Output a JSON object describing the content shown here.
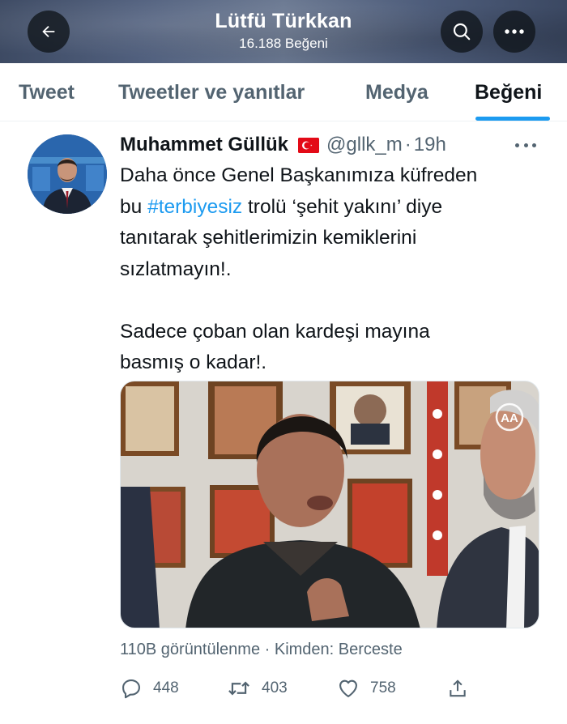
{
  "header": {
    "title": "Lütfü Türkkan",
    "subtitle": "16.188 Beğeni",
    "back_icon": "arrow-left-icon",
    "search_icon": "search-icon",
    "more_icon": "more-horizontal-icon"
  },
  "tabs": [
    {
      "label": "Tweet",
      "active": false
    },
    {
      "label": "Tweetler ve yanıtlar",
      "active": false
    },
    {
      "label": "Medya",
      "active": false
    },
    {
      "label": "Beğeni",
      "active": true
    }
  ],
  "tweet": {
    "author_name": "Muhammet Güllük",
    "handle": "@gllk_m",
    "separator": "·",
    "time": "19h",
    "text": {
      "line1": "Daha önce Genel Başkanımıza küfreden",
      "line2_prefix": "bu ",
      "hashtag": "#terbiyesiz",
      "line2_suffix": " trolü ‘şehit yakını’ diye",
      "line3": "tanıtarak şehitlerimizin kemiklerini",
      "line4": "sızlatmayın!.",
      "line5": "Sadece çoban olan kardeşi mayına",
      "line6": "basmış o kadar!."
    },
    "media": {
      "watermark": "AA"
    },
    "meta": "110B görüntülenme · Kimden: Berceste",
    "actions": {
      "replies": "448",
      "retweets": "403",
      "likes": "758"
    }
  },
  "colors": {
    "accent": "#1d9bf0",
    "secondary_text": "#536471",
    "primary_text": "#0f1419",
    "flag_red": "#e30a17"
  }
}
